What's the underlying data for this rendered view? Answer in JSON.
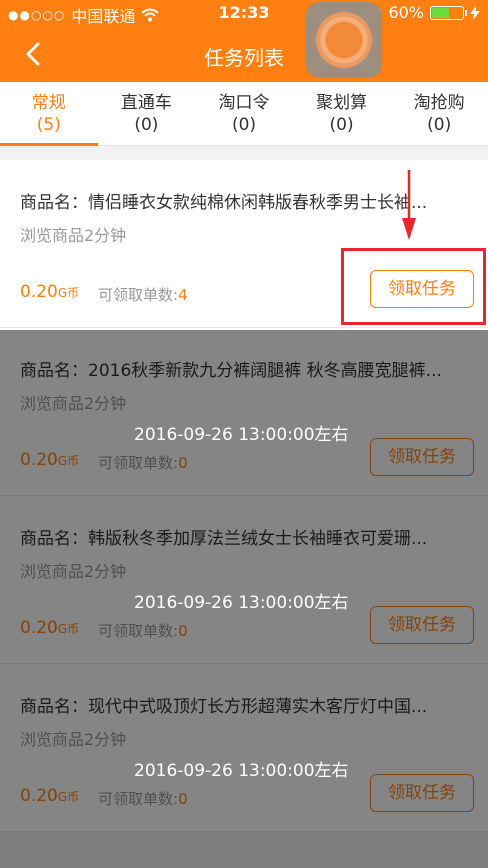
{
  "status_bar": {
    "carrier": "中国联通",
    "signal": "●●○○○",
    "wifi": "wifi-icon",
    "time": "12:33",
    "battery_percent": "60%",
    "battery_level": 0.6,
    "lock_icon": "rotation-lock-icon",
    "charge_icon": "bolt-icon"
  },
  "nav": {
    "title": "任务列表",
    "back_icon": "chevron-left-icon",
    "float_icon": "assistive-touch-icon"
  },
  "tabs": [
    {
      "label": "常规",
      "count": "(5)",
      "active": true
    },
    {
      "label": "直通车",
      "count": "(0)",
      "active": false
    },
    {
      "label": "淘口令",
      "count": "(0)",
      "active": false
    },
    {
      "label": "聚划算",
      "count": "(0)",
      "active": false
    },
    {
      "label": "淘抢购",
      "count": "(0)",
      "active": false
    }
  ],
  "items": [
    {
      "name": "商品名：情侣睡衣女款纯棉休闲韩版春秋季男士长袖...",
      "browse": "浏览商品2分钟",
      "time_note": "",
      "price": "0.20",
      "currency": "G币",
      "count_label": "可领取单数:",
      "count_value": "4",
      "button": "领取任务"
    },
    {
      "name": "商品名：2016秋季新款九分裤阔腿裤 秋冬高腰宽腿裤...",
      "browse": "浏览商品2分钟",
      "time_note": "2016-09-26 13:00:00左右",
      "price": "0.20",
      "currency": "G币",
      "count_label": "可领取单数:",
      "count_value": "0",
      "button": "领取任务"
    },
    {
      "name": "商品名：韩版秋冬季加厚法兰绒女士长袖睡衣可爱珊...",
      "browse": "浏览商品2分钟",
      "time_note": "2016-09-26 13:00:00左右",
      "price": "0.20",
      "currency": "G币",
      "count_label": "可领取单数:",
      "count_value": "0",
      "button": "领取任务"
    },
    {
      "name": "商品名：现代中式吸顶灯长方形超薄实木客厅灯中国...",
      "browse": "浏览商品2分钟",
      "time_note": "2016-09-26 13:00:00左右",
      "price": "0.20",
      "currency": "G币",
      "count_label": "可领取单数:",
      "count_value": "0",
      "button": "领取任务"
    }
  ],
  "colors": {
    "brand": "#ff7f10",
    "highlight": "#e8262d"
  }
}
